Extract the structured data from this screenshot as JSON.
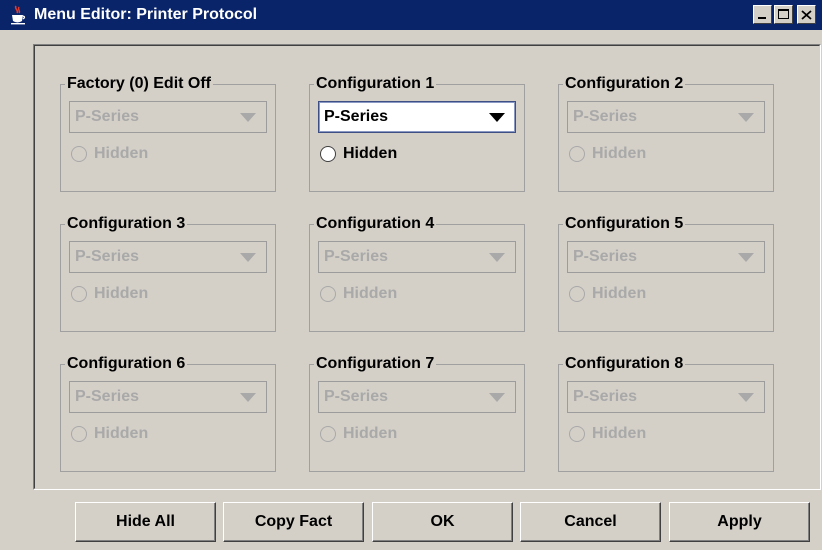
{
  "window": {
    "title": "Menu Editor: Printer Protocol",
    "app_icon": "java-cup-icon"
  },
  "groups": [
    {
      "title": "Factory (0) Edit Off",
      "value": "P-Series",
      "hidden_label": "Hidden",
      "enabled": false
    },
    {
      "title": "Configuration 1",
      "value": "P-Series",
      "hidden_label": "Hidden",
      "enabled": true
    },
    {
      "title": "Configuration 2",
      "value": "P-Series",
      "hidden_label": "Hidden",
      "enabled": false
    },
    {
      "title": "Configuration 3",
      "value": "P-Series",
      "hidden_label": "Hidden",
      "enabled": false
    },
    {
      "title": "Configuration 4",
      "value": "P-Series",
      "hidden_label": "Hidden",
      "enabled": false
    },
    {
      "title": "Configuration 5",
      "value": "P-Series",
      "hidden_label": "Hidden",
      "enabled": false
    },
    {
      "title": "Configuration 6",
      "value": "P-Series",
      "hidden_label": "Hidden",
      "enabled": false
    },
    {
      "title": "Configuration 7",
      "value": "P-Series",
      "hidden_label": "Hidden",
      "enabled": false
    },
    {
      "title": "Configuration 8",
      "value": "P-Series",
      "hidden_label": "Hidden",
      "enabled": false
    }
  ],
  "buttons": {
    "hide_all": "Hide All",
    "copy_fact": "Copy Fact",
    "ok": "OK",
    "cancel": "Cancel",
    "apply": "Apply"
  },
  "colors": {
    "titlebar": "#0a246a",
    "disabled_text": "#a9a9a9",
    "background": "#d4d0c8"
  }
}
